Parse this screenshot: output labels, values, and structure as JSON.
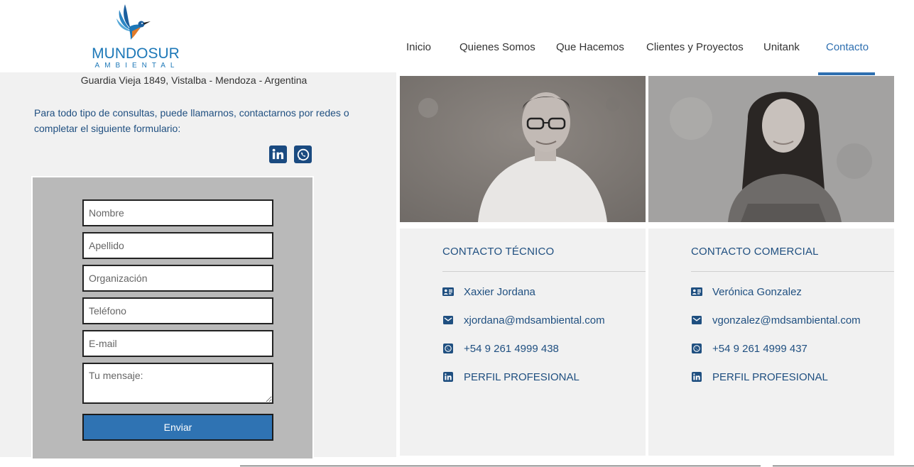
{
  "logo": {
    "name": "MUNDOSUR",
    "sub": "AMBIENTAL"
  },
  "nav": {
    "items": [
      {
        "label": "Inicio"
      },
      {
        "label": "Quienes Somos"
      },
      {
        "label": "Que Hacemos"
      },
      {
        "label": "Clientes y Proyectos"
      },
      {
        "label": "Unitank"
      },
      {
        "label": "Contacto"
      }
    ],
    "active": "Contacto"
  },
  "left": {
    "address": "Guardia Vieja 1849, Vistalba - Mendoza - Argentina",
    "intro": "Para todo tipo de consultas, puede llamarnos, contactarnos por redes o completar el siguiente formulario:",
    "social": [
      "linkedin-icon",
      "whatsapp-icon"
    ]
  },
  "form": {
    "nombre": "Nombre",
    "apellido": "Apellido",
    "organizacion": "Organización",
    "telefono": "Teléfono",
    "email": "E-mail",
    "mensaje": "Tu mensaje:",
    "submit": "Enviar"
  },
  "contacts": [
    {
      "title": "CONTACTO TÉCNICO",
      "name": "Xaxier Jordana",
      "email": "xjordana@mdsambiental.com",
      "phone": "+54 9 261 4999 438",
      "profile": "PERFIL PROFESIONAL"
    },
    {
      "title": "CONTACTO COMERCIAL",
      "name": "Verónica Gonzalez",
      "email": "vgonzalez@mdsambiental.com",
      "phone": "+54 9 261 4999 437",
      "profile": "PERFIL PROFESIONAL"
    }
  ],
  "colors": {
    "accent": "#2e6fb0",
    "text_blue": "#1f4f80",
    "panel": "#f1f1f1",
    "form_bg": "#b9b9b9",
    "button": "#2f73b3"
  }
}
